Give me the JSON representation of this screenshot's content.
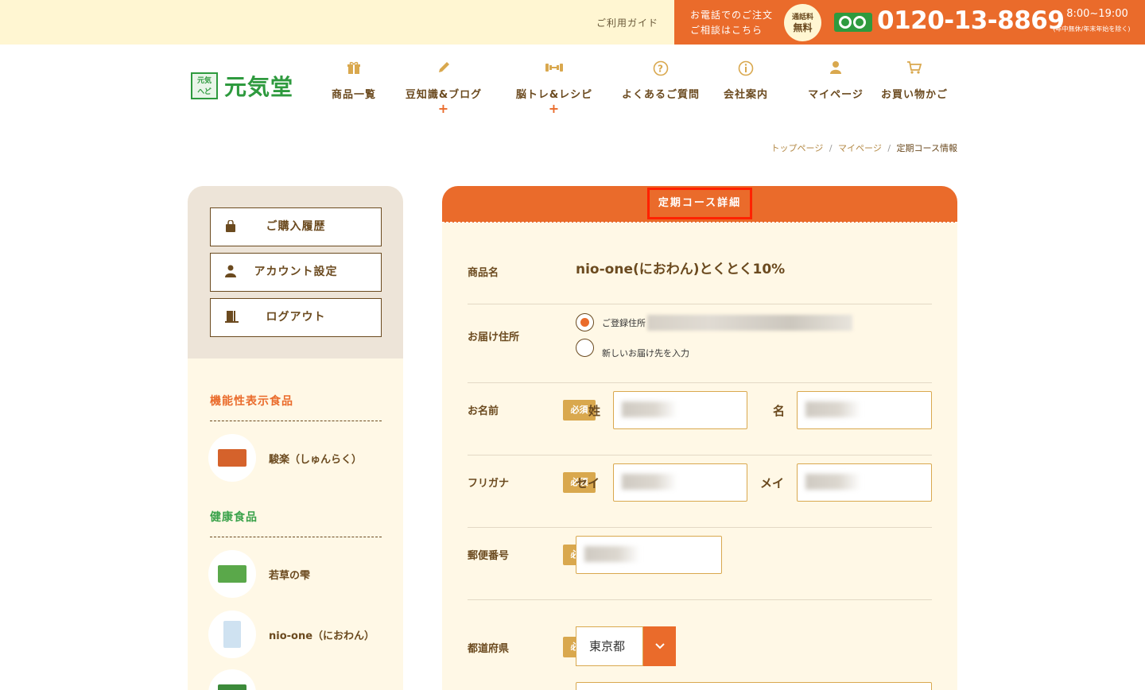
{
  "topbar": {
    "guide_link": "ご利用ガイド",
    "phone_text_line1": "お電話でのご注文",
    "phone_text_line2": "ご相談はこちら",
    "free_badge_line1": "通話料",
    "free_badge_line2": "無料",
    "phone_number": "0120-13-8869",
    "hours": "8:00~19:00",
    "hours_note": "(年中無休/年末年始を除く)"
  },
  "header": {
    "logo_mark": "元もと気きへどう",
    "logo_text": "元気堂",
    "nav": [
      {
        "label": "商品一覧",
        "icon": "gift-icon",
        "glyph": "🎁",
        "plus": ""
      },
      {
        "label": "豆知識&ブログ",
        "icon": "pencil-icon",
        "glyph": "✎",
        "plus": "+"
      },
      {
        "label": "脳トレ&レシピ",
        "icon": "dumbbell-icon",
        "glyph": "⊢⊣",
        "plus": "+"
      },
      {
        "label": "よくあるご質問",
        "icon": "question-icon",
        "glyph": "?",
        "plus": ""
      },
      {
        "label": "会社案内",
        "icon": "info-icon",
        "glyph": "i",
        "plus": ""
      },
      {
        "label": "マイページ",
        "icon": "user-icon",
        "glyph": "👤",
        "plus": ""
      },
      {
        "label": "お買い物かご",
        "icon": "cart-icon",
        "glyph": "🛒",
        "plus": ""
      }
    ]
  },
  "breadcrumb": {
    "items": [
      "トップページ",
      "マイページ"
    ],
    "separator": "/",
    "current": "定期コース情報"
  },
  "sidebar": {
    "buttons": [
      {
        "label": "ご購入履歴",
        "icon": "bag-icon",
        "glyph": "👜"
      },
      {
        "label": "アカウント設定",
        "icon": "user-icon",
        "glyph": "👤"
      },
      {
        "label": "ログアウト",
        "icon": "door-icon",
        "glyph": "🚪"
      }
    ],
    "categories": [
      {
        "label": "機能性表示食品",
        "color": "#ea6b2b"
      },
      {
        "label": "健康食品",
        "color": "#3aa24a"
      }
    ],
    "products": [
      {
        "label": "駿楽（しゅんらく）",
        "pkg_color": "#d5622b"
      },
      {
        "label": "若草の雫",
        "pkg_color": "#5aa84a"
      },
      {
        "label": "nio-one（におわん）",
        "pkg_color": "#cfe2f1"
      },
      {
        "label": "",
        "pkg_color": "#3c8a3a"
      }
    ]
  },
  "card": {
    "title": "定期コース詳細",
    "product_label": "商品名",
    "product_name": "nio-one(におわん)とくとく10%",
    "address_label": "お届け住所",
    "address_option1": "ご登録住所",
    "address_option2": "新しいお届け先を入力",
    "name_label": "お名前",
    "required": "必須",
    "last_name_label": "姓",
    "first_name_label": "名",
    "kana_label": "フリガナ",
    "kana_last_label": "セイ",
    "kana_first_label": "メイ",
    "postal_label": "郵便番号",
    "pref_label": "都道府県",
    "pref_value": "東京都"
  },
  "colors": {
    "accent": "#ea6b2b",
    "brand_green": "#2e9a3e",
    "gold": "#d9a84e",
    "text_brown": "#6b4a1f",
    "cream": "#fff8e6"
  }
}
